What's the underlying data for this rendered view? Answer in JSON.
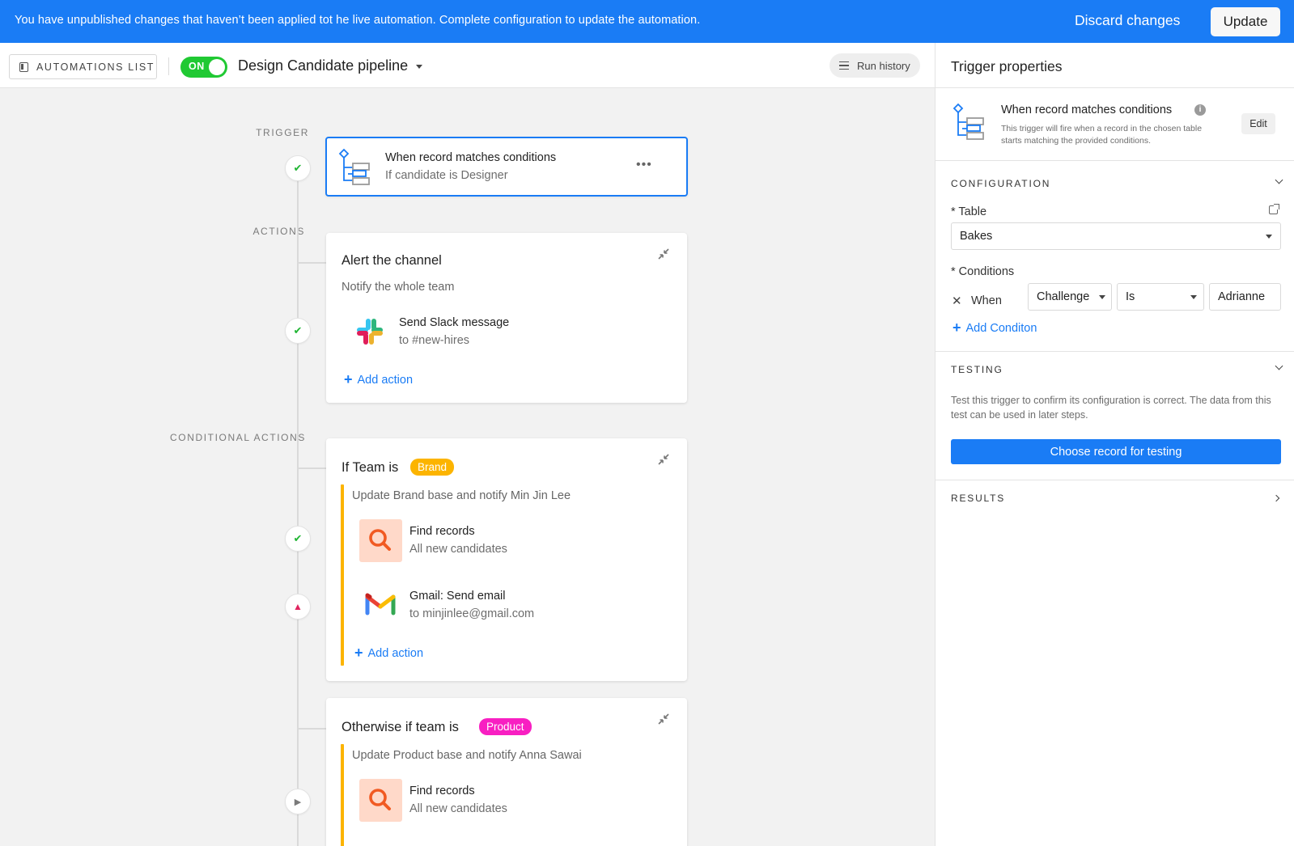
{
  "banner": {
    "message": "You have unpublished changes that haven’t been applied tot he live automation. Complete configuration to update the automation.",
    "discard_label": "Discard changes",
    "update_label": "Update"
  },
  "toolbar": {
    "automations_list_label": "AUTOMATIONS LIST",
    "toggle_label": "ON",
    "toggle_on": true,
    "pipeline_name": "Design Candidate pipeline",
    "run_history_label": "Run history"
  },
  "canvas": {
    "trigger_label": "TRIGGER",
    "actions_label": "ACTIONS",
    "conditional_label": "CONDITIONAL ACTIONS",
    "trigger": {
      "title": "When record matches conditions",
      "subtitle": "If candidate is Designer",
      "more_label": "•••",
      "status": "success"
    },
    "action_group": {
      "title": "Alert the channel",
      "subtitle": "Notify the whole team",
      "status": "success",
      "steps": [
        {
          "title": "Send Slack message",
          "subtitle": "to #new-hires",
          "icon": "slack-icon"
        }
      ],
      "add_action_label": "Add action"
    },
    "condition_1": {
      "title": "If Team is",
      "badge": "Brand",
      "badge_color": "#fcb400",
      "subtitle": "Update Brand base and notify Min Jin Lee",
      "steps": [
        {
          "title": "Find records",
          "subtitle": "All new candidates",
          "icon": "search-icon",
          "status": "success"
        },
        {
          "title": "Gmail: Send email",
          "subtitle": "to minjinlee@gmail.com",
          "icon": "gmail-icon",
          "status": "warning"
        }
      ],
      "add_action_label": "Add action"
    },
    "condition_2": {
      "title": "Otherwise if team is",
      "badge": "Product",
      "badge_color": "#f81fc2",
      "subtitle": "Update Product base and notify Anna Sawai",
      "steps": [
        {
          "title": "Find records",
          "subtitle": "All new candidates",
          "icon": "search-icon",
          "status": "pending"
        }
      ]
    }
  },
  "panel": {
    "title": "Trigger properties",
    "trigger_title": "When record matches conditions",
    "trigger_info": "i",
    "trigger_desc": "This trigger will fire when a record in the chosen table starts matching the provided conditions.",
    "edit_label": "Edit",
    "configuration_label": "CONFIGURATION",
    "table_label": "* Table",
    "table_value": "Bakes",
    "conditions_label": "* Conditions",
    "condition": {
      "when": "When",
      "field": "Challenge",
      "operator": "Is",
      "value": "Adrianne"
    },
    "add_condition_label": "Add Conditon",
    "testing_label": "TESTING",
    "testing_desc": "Test this trigger to confirm its configuration is correct. The data from this test can be used in later steps.",
    "choose_record_label": "Choose record for testing",
    "results_label": "RESULTS"
  },
  "colors": {
    "accent": "#1a7cf5",
    "success": "#20c933",
    "warning": "#e0245e",
    "brand_badge": "#fcb400",
    "product_badge": "#f81fc2"
  }
}
